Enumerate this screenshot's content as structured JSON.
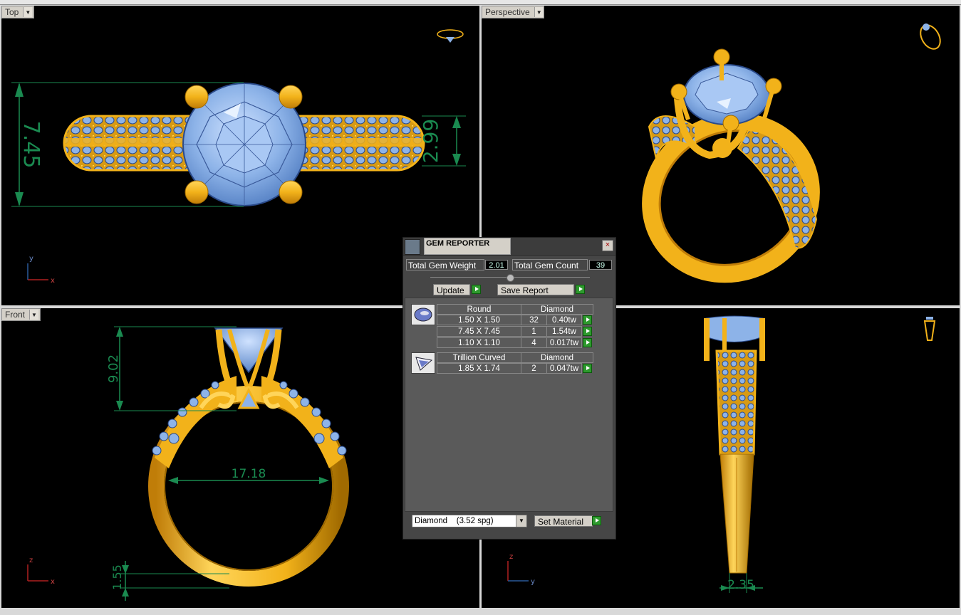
{
  "viewports": {
    "top": {
      "label": "Top",
      "dims": {
        "height": "7.45",
        "band": "2.99"
      },
      "axes": {
        "v": "y",
        "h": "x"
      }
    },
    "perspective": {
      "label": "Perspective"
    },
    "front": {
      "label": "Front",
      "dims": {
        "head": "9.02",
        "ring_size": "17.18",
        "shank": "1.55"
      },
      "axes": {
        "v": "z",
        "h": "x"
      }
    },
    "right": {
      "label": "",
      "dims": {
        "width": "2.35"
      },
      "axes": {
        "v": "z",
        "h": "y"
      }
    }
  },
  "colors": {
    "gold": "#f2b21a",
    "gem": "#8db3e8",
    "dimension": "#1a8a50",
    "viewport_bg": "#000000"
  },
  "gem_reporter": {
    "title": "GEM REPORTER",
    "close_glyph": "×",
    "total_weight_label": "Total Gem Weight",
    "total_weight_value": "2.01",
    "total_count_label": "Total Gem Count",
    "total_count_value": "39",
    "update_label": "Update",
    "save_report_label": "Save Report",
    "groups": [
      {
        "shape": "Round",
        "material": "Diamond",
        "rows": [
          {
            "size": "1.50 X 1.50",
            "count": "32",
            "weight": "0.40tw"
          },
          {
            "size": "7.45 X 7.45",
            "count": "1",
            "weight": "1.54tw"
          },
          {
            "size": "1.10 X 1.10",
            "count": "4",
            "weight": "0.017tw"
          }
        ]
      },
      {
        "shape": "Trillion Curved",
        "material": "Diamond",
        "rows": [
          {
            "size": "1.85 X 1.74",
            "count": "2",
            "weight": "0.047tw"
          }
        ]
      }
    ],
    "material_select": "Diamond    (3.52 spg)",
    "set_material_label": "Set Material"
  }
}
